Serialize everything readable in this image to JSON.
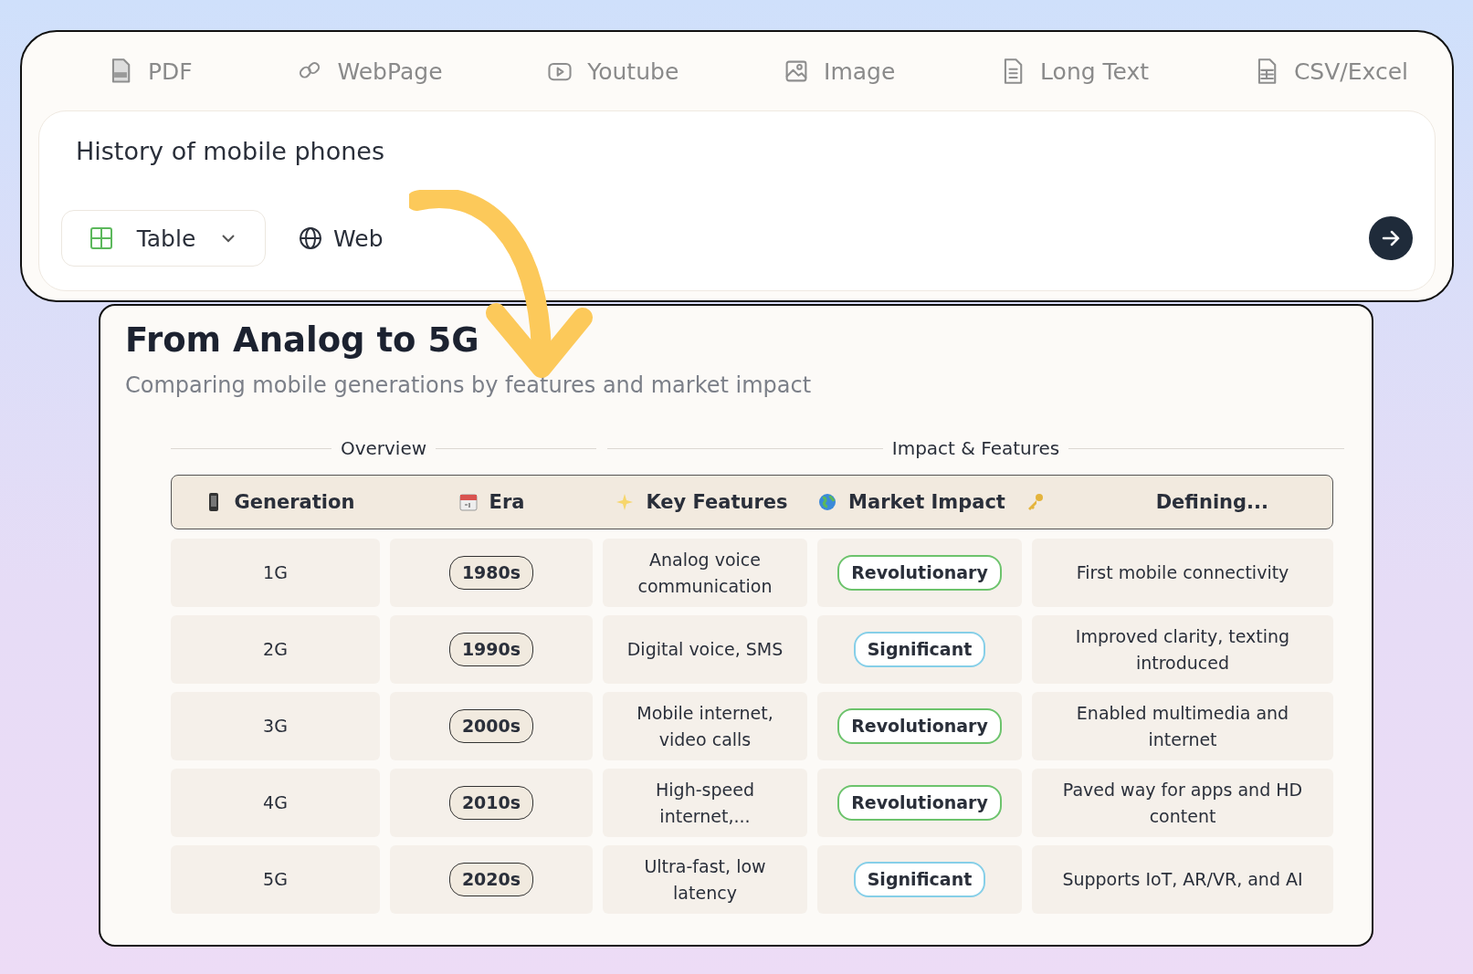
{
  "source_tabs": [
    {
      "kind": "pdf",
      "label": "PDF"
    },
    {
      "kind": "link",
      "label": "WebPage"
    },
    {
      "kind": "video",
      "label": "Youtube"
    },
    {
      "kind": "image",
      "label": "Image"
    },
    {
      "kind": "document",
      "label": "Long Text"
    },
    {
      "kind": "spreadsheet",
      "label": "CSV/Excel"
    }
  ],
  "prompt": {
    "value": "History of mobile phones",
    "format_button": "Table",
    "web_toggle": "Web"
  },
  "result": {
    "title": "From Analog to 5G",
    "subtitle": "Comparing mobile generations by features and market impact",
    "column_groups": [
      {
        "label": "Overview"
      },
      {
        "label": "Impact & Features"
      }
    ],
    "columns": [
      {
        "kind": "phone",
        "label": "Generation"
      },
      {
        "kind": "calendar",
        "label": "Era"
      },
      {
        "kind": "sparkle",
        "label": "Key Features"
      },
      {
        "kind": "globe",
        "label": "Market Impact"
      },
      {
        "kind": "key",
        "label": "Defining..."
      }
    ],
    "rows": [
      {
        "generation": "1G",
        "era": "1980s",
        "features": "Analog voice communication",
        "impact": {
          "label": "Revolutionary",
          "color": "#6cc36c"
        },
        "defining": "First mobile connectivity"
      },
      {
        "generation": "2G",
        "era": "1990s",
        "features": "Digital voice, SMS",
        "impact": {
          "label": "Significant",
          "color": "#86cfe8"
        },
        "defining": "Improved clarity, texting introduced"
      },
      {
        "generation": "3G",
        "era": "2000s",
        "features": "Mobile internet, video calls",
        "impact": {
          "label": "Revolutionary",
          "color": "#6cc36c"
        },
        "defining": "Enabled multimedia and internet"
      },
      {
        "generation": "4G",
        "era": "2010s",
        "features": "High-speed internet,...",
        "impact": {
          "label": "Revolutionary",
          "color": "#6cc36c"
        },
        "defining": "Paved way for apps and HD content"
      },
      {
        "generation": "5G",
        "era": "2020s",
        "features": "Ultra-fast, low latency",
        "impact": {
          "label": "Significant",
          "color": "#86cfe8"
        },
        "defining": "Supports IoT, AR/VR, and AI"
      }
    ]
  }
}
